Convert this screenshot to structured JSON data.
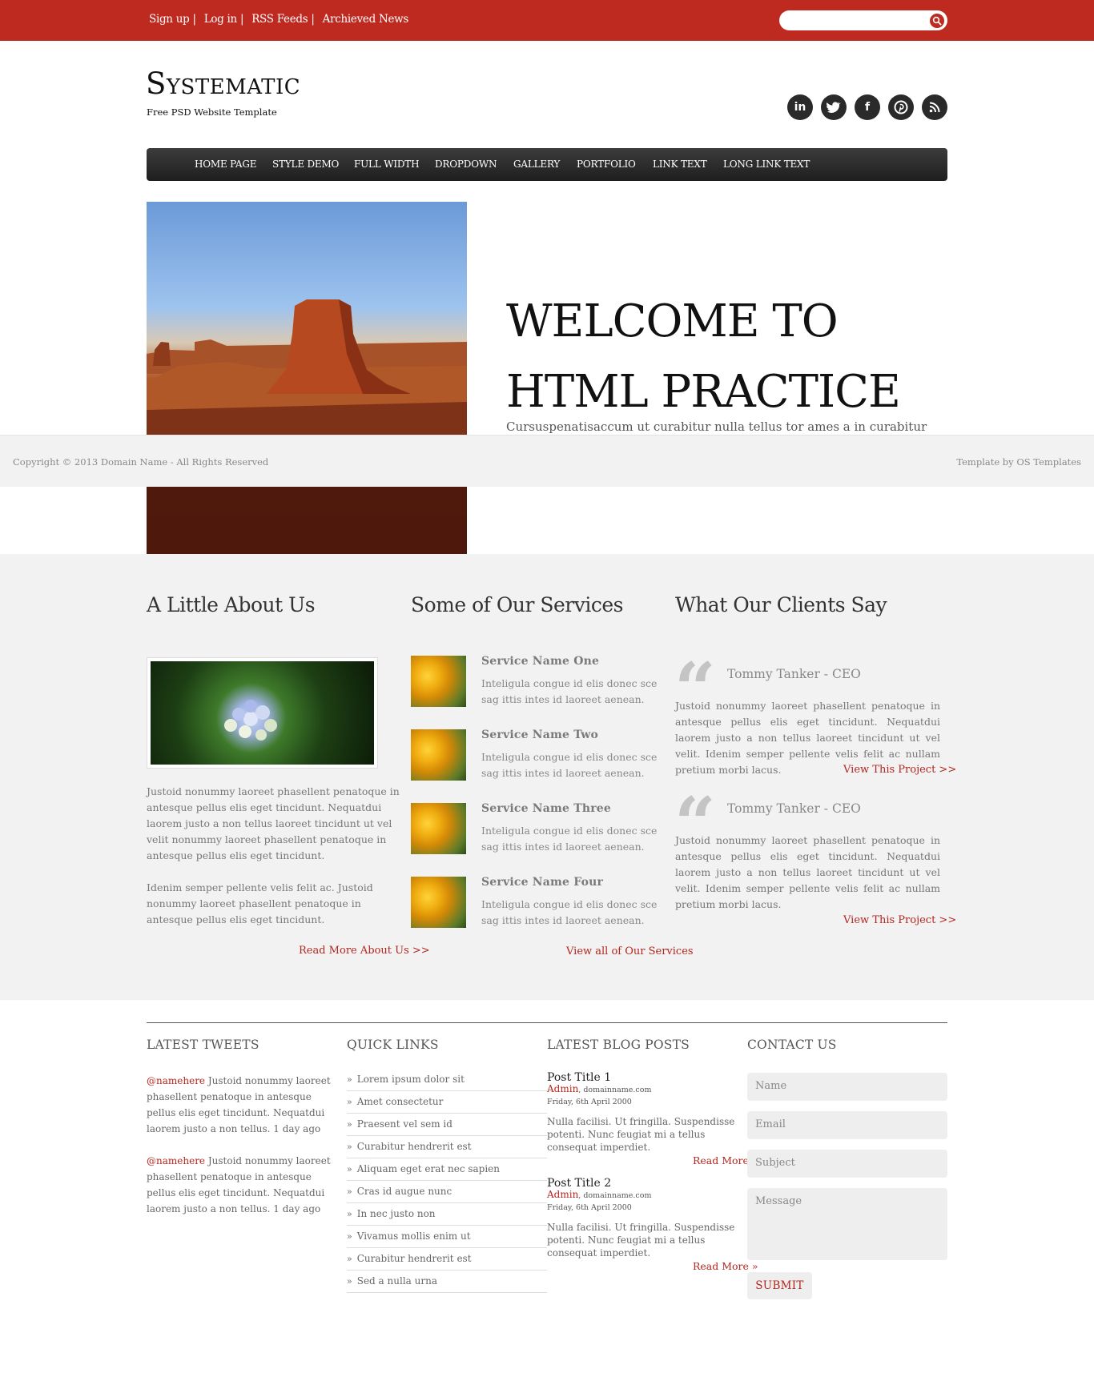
{
  "topbar": {
    "links": [
      "Sign up",
      "Log in",
      "RSS Feeds",
      "Archieved News"
    ],
    "separator": "|",
    "search_placeholder": ""
  },
  "header": {
    "logo": "Systematic",
    "tagline": "Free PSD Website Template",
    "social": [
      "in",
      "t",
      "f",
      "p",
      "rss"
    ]
  },
  "nav": [
    "HOME PAGE",
    "STYLE DEMO",
    "FULL WIDTH",
    "DROPDOWN",
    "GALLERY",
    "PORTFOLIO",
    "LINK TEXT",
    "LONG LINK TEXT"
  ],
  "hero": {
    "title_line1": "WELCOME TO",
    "title_line2": "HTML PRACTICE",
    "text": "Cursuspenatisaccum ut curabitur nulla tellus tor ames a in curabitur pede."
  },
  "copyright": {
    "left": "Copyright © 2013 Domain Name - All Rights Reserved",
    "right": "Template by OS Templates"
  },
  "about": {
    "heading": "A Little About Us",
    "para1": "Justoid nonummy laoreet phasellent penatoque in antesque pellus elis eget tincidunt. Nequatdui laorem justo a non tellus laoreet tincidunt ut vel velit nonummy laoreet phasellent penatoque in antesque pellus elis eget tincidunt.",
    "para2": "Idenim semper pellente velis felit ac. Justoid nonummy laoreet phasellent penatoque in antesque pellus elis eget tincidunt.",
    "link": "Read More About Us >>"
  },
  "services": {
    "heading": "Some of Our Services",
    "items": [
      {
        "name": "Service Name One",
        "text": "Inteligula congue id elis donec sce sag ittis intes id laoreet aenean."
      },
      {
        "name": "Service Name Two",
        "text": "Inteligula congue id elis donec sce sag ittis intes id laoreet aenean."
      },
      {
        "name": "Service Name Three",
        "text": "Inteligula congue id elis donec sce sag ittis intes id laoreet aenean."
      },
      {
        "name": "Service Name Four",
        "text": "Inteligula congue id elis donec sce sag ittis intes id laoreet aenean."
      }
    ],
    "link": "View all of Our Services"
  },
  "clients": {
    "heading": "What Our Clients Say",
    "quote_mark": "“",
    "items": [
      {
        "name": "Tommy Tanker - CEO",
        "text": "Justoid nonummy laoreet phasellent penatoque in antesque pellus elis eget tincidunt. Nequatdui laorem justo a non tellus laoreet tincidunt ut vel velit. Idenim semper pellente velis felit ac nullam pretium morbi lacus.",
        "link": "View This Project >>"
      },
      {
        "name": "Tommy Tanker - CEO",
        "text": "Justoid nonummy laoreet phasellent penatoque in antesque pellus elis eget tincidunt. Nequatdui laorem justo a non tellus laoreet tincidunt ut vel velit. Idenim semper pellente velis felit ac nullam pretium morbi lacus.",
        "link": "View This Project >>"
      }
    ]
  },
  "footer": {
    "tweets": {
      "heading": "LATEST TWEETS",
      "items": [
        {
          "handle": "@namehere",
          "text": " Justoid nonummy laoreet phasellent penatoque in antesque pellus elis eget tincidunt. Nequatdui laorem justo a non tellus. 1 day ago"
        },
        {
          "handle": "@namehere",
          "text": " Justoid nonummy laoreet phasellent penatoque in antesque pellus elis eget tincidunt. Nequatdui laorem justo a non tellus. 1 day ago"
        }
      ]
    },
    "quicklinks": {
      "heading": "QUICK LINKS",
      "chevron": "»",
      "items": [
        "Lorem ipsum dolor sit",
        "Amet consectetur",
        "Praesent vel sem id",
        "Curabitur hendrerit est",
        "Aliquam eget erat nec sapien",
        "Cras id augue nunc",
        "In nec justo non",
        "Vivamus mollis enim ut",
        "Curabitur hendrerit est",
        "Sed a nulla urna"
      ]
    },
    "blog": {
      "heading": "LATEST BLOG POSTS",
      "items": [
        {
          "title": "Post Title 1",
          "author": "Admin",
          "domain": ", domainname.com",
          "date": "Friday, 6th April 2000",
          "text": "Nulla facilisi. Ut fringilla. Suspendisse potenti. Nunc feugiat mi a tellus consequat imperdiet.",
          "more": "Read More »"
        },
        {
          "title": "Post Title 2",
          "author": "Admin",
          "domain": ", domainname.com",
          "date": "Friday, 6th April 2000",
          "text": "Nulla facilisi. Ut fringilla. Suspendisse potenti. Nunc feugiat mi a tellus consequat imperdiet.",
          "more": "Read More »"
        }
      ]
    },
    "contact": {
      "heading": "CONTACT US",
      "name": "Name",
      "email": "Email",
      "subject": "Subject",
      "message": "Message",
      "submit": "SUBMIT"
    }
  },
  "colors": {
    "brand_red": "#bf2a20",
    "link_red": "#b3261e",
    "nav_dark": "#2a2a2a",
    "section_grey": "#f2f2f2"
  }
}
